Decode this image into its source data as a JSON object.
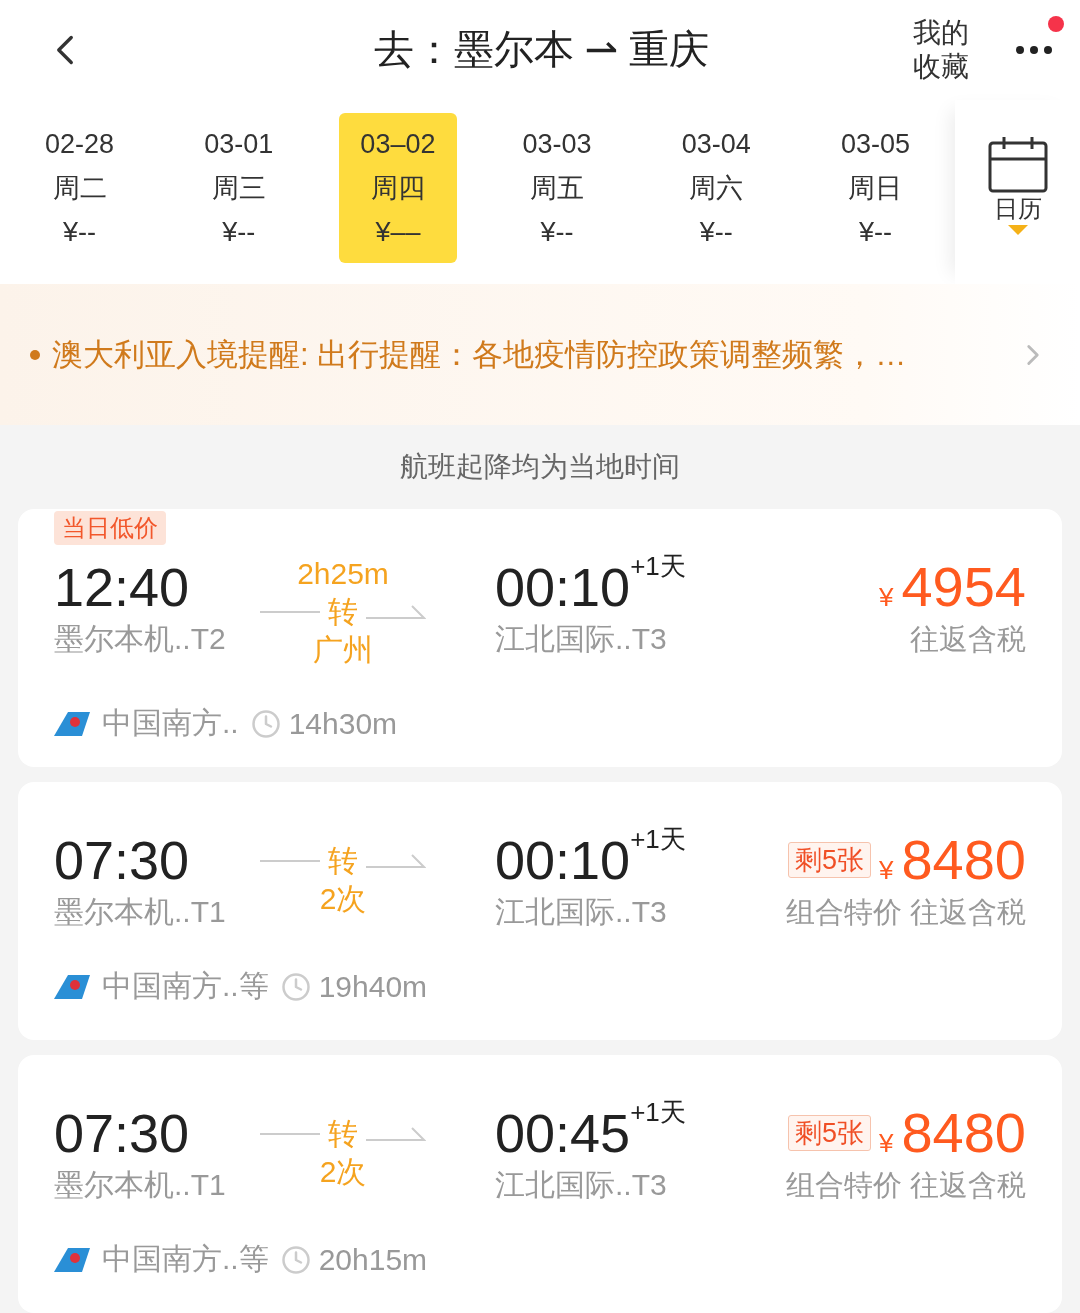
{
  "header": {
    "title": "去：墨尔本 ⇀ 重庆",
    "favorites": "我的收藏",
    "has_notification": true
  },
  "dates": [
    {
      "date": "02-28",
      "weekday": "周二",
      "price": "¥--",
      "selected": false
    },
    {
      "date": "03-01",
      "weekday": "周三",
      "price": "¥--",
      "selected": false
    },
    {
      "date": "03–02",
      "weekday": "周四",
      "price": "¥––",
      "selected": true
    },
    {
      "date": "03-03",
      "weekday": "周五",
      "price": "¥--",
      "selected": false
    },
    {
      "date": "03-04",
      "weekday": "周六",
      "price": "¥--",
      "selected": false
    },
    {
      "date": "03-05",
      "weekday": "周日",
      "price": "¥--",
      "selected": false
    }
  ],
  "calendar": {
    "label": "日历"
  },
  "notice": {
    "text": "澳大利亚入境提醒: 出行提醒：各地疫情防控政策调整频繁，…"
  },
  "caption": "航班起降均为当地时间",
  "flights": [
    {
      "tag": "当日低价",
      "depart_time": "12:40",
      "depart_airport": "墨尔本机..T2",
      "transfer_duration": "2h25m",
      "transfer_label": "转",
      "transfer_detail": "广州",
      "arrive_time": "00:10",
      "next_day": "+1天",
      "arrive_airport": "江北国际..T3",
      "currency": "¥",
      "price": "4954",
      "price_note": "往返含税",
      "airline": "中国南方..",
      "duration": "14h30m"
    },
    {
      "depart_time": "07:30",
      "depart_airport": "墨尔本机..T1",
      "transfer_label": "转",
      "transfer_detail": "2次",
      "arrive_time": "00:10",
      "next_day": "+1天",
      "arrive_airport": "江北国际..T3",
      "remaining": "剩5张",
      "currency": "¥",
      "price": "8480",
      "price_note": "组合特价 往返含税",
      "airline": "中国南方..等",
      "duration": "19h40m"
    },
    {
      "depart_time": "07:30",
      "depart_airport": "墨尔本机..T1",
      "transfer_label": "转",
      "transfer_detail": "2次",
      "arrive_time": "00:45",
      "next_day": "+1天",
      "arrive_airport": "江北国际..T3",
      "remaining": "剩5张",
      "currency": "¥",
      "price": "8480",
      "price_note": "组合特价 往返含税",
      "airline": "中国南方..等",
      "duration": "20h15m"
    }
  ]
}
